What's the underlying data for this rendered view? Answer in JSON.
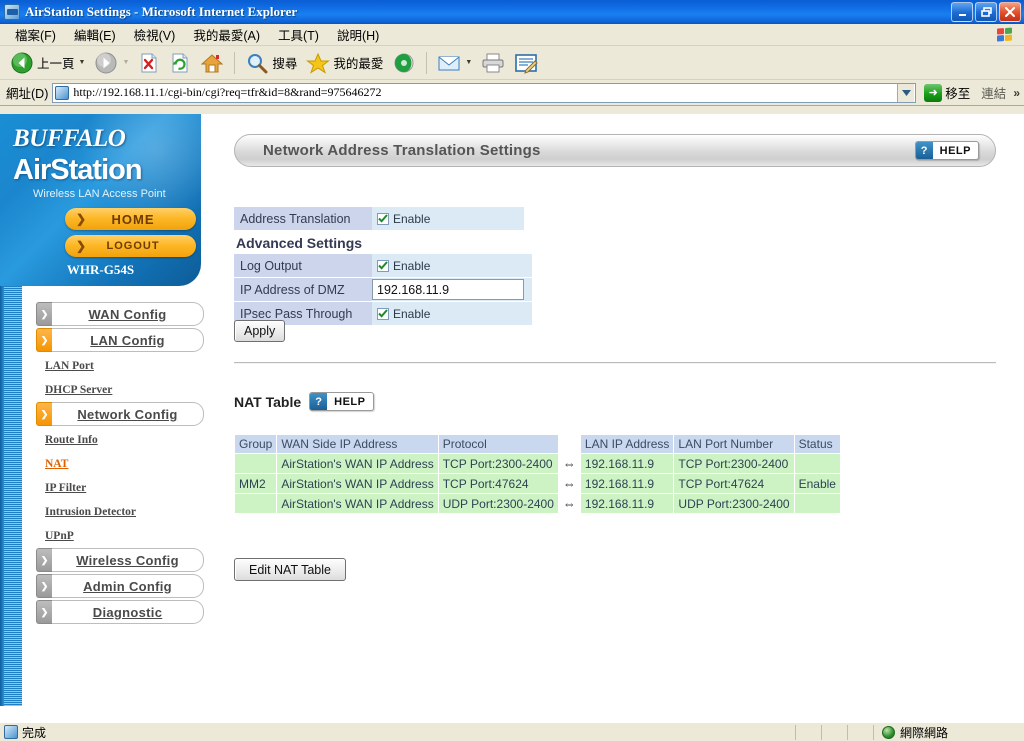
{
  "window": {
    "title": "AirStation Settings - Microsoft Internet Explorer",
    "app_icon": "ie-document-icon",
    "minimize_label": "Minimize",
    "restore_label": "Restore",
    "close_label": "Close"
  },
  "menubar": {
    "items": [
      {
        "label": "檔案(F)",
        "name": "menu-file"
      },
      {
        "label": "編輯(E)",
        "name": "menu-edit"
      },
      {
        "label": "檢視(V)",
        "name": "menu-view"
      },
      {
        "label": "我的最愛(A)",
        "name": "menu-favorites"
      },
      {
        "label": "工具(T)",
        "name": "menu-tools"
      },
      {
        "label": "說明(H)",
        "name": "menu-help"
      }
    ]
  },
  "toolbar": {
    "back_label": "上一頁",
    "forward_label": "",
    "search_label": "搜尋",
    "favorites_label": "我的最愛",
    "icons": {
      "back": "back-arrow-icon",
      "forward": "forward-arrow-icon",
      "stop": "stop-icon",
      "refresh": "refresh-icon",
      "home": "home-icon",
      "search": "magnifier-icon",
      "favorites": "star-icon",
      "media": "media-icon",
      "mail": "mail-icon",
      "print": "printer-icon",
      "edit": "edit-page-icon"
    }
  },
  "addressbar": {
    "label": "網址(D)",
    "url": "http://192.168.11.1/cgi-bin/cgi?req=tfr&id=8&rand=975646272",
    "go_label": "移至",
    "links_label": "連結",
    "overflow": "»"
  },
  "sidebar": {
    "brand": "BUFFALO",
    "product": "AirStation",
    "tagline": "Wireless LAN Access Point",
    "home_button": "HOME",
    "logout_button": "LOGOUT",
    "model": "WHR-G54S",
    "menu": [
      {
        "label": "WAN Config",
        "type": "main",
        "active": false,
        "name": "sidebar-item-wan-config"
      },
      {
        "label": "LAN Config",
        "type": "main",
        "active": true,
        "name": "sidebar-item-lan-config"
      },
      {
        "label": "LAN Port",
        "type": "sub",
        "current": false,
        "name": "sidebar-item-lan-port"
      },
      {
        "label": "DHCP Server",
        "type": "sub",
        "current": false,
        "name": "sidebar-item-dhcp-server"
      },
      {
        "label": "Network Config",
        "type": "main",
        "active": true,
        "name": "sidebar-item-network-config"
      },
      {
        "label": "Route Info",
        "type": "sub",
        "current": false,
        "name": "sidebar-item-route-info"
      },
      {
        "label": "NAT",
        "type": "sub",
        "current": true,
        "name": "sidebar-item-nat"
      },
      {
        "label": "IP Filter",
        "type": "sub",
        "current": false,
        "name": "sidebar-item-ip-filter"
      },
      {
        "label": "Intrusion Detector",
        "type": "sub",
        "current": false,
        "name": "sidebar-item-intrusion-detector"
      },
      {
        "label": "UPnP",
        "type": "sub",
        "current": false,
        "name": "sidebar-item-upnp"
      },
      {
        "label": "Wireless Config",
        "type": "main",
        "active": false,
        "name": "sidebar-item-wireless-config"
      },
      {
        "label": "Admin Config",
        "type": "main",
        "active": false,
        "name": "sidebar-item-admin-config"
      },
      {
        "label": "Diagnostic",
        "type": "main",
        "active": false,
        "name": "sidebar-item-diagnostic"
      }
    ]
  },
  "main": {
    "page_title": "Network Address Translation Settings",
    "help_label": "HELP",
    "help_mark": "?",
    "settings": {
      "address_translation_label": "Address Translation",
      "address_translation_value": "Enable",
      "address_translation_checked": true,
      "advanced_heading": "Advanced Settings",
      "log_output_label": "Log Output",
      "log_output_value": "Enable",
      "log_output_checked": true,
      "dmz_label": "IP Address of DMZ",
      "dmz_value": "192.168.11.9",
      "ipsec_label": "IPsec Pass Through",
      "ipsec_value": "Enable",
      "ipsec_checked": true,
      "apply_label": "Apply"
    },
    "nat_table": {
      "section_label": "NAT Table",
      "help_label": "HELP",
      "columns": [
        "Group",
        "WAN Side IP Address",
        "Protocol",
        "",
        "LAN IP Address",
        "LAN Port Number",
        "Status"
      ],
      "arrow_glyph": "⇔",
      "rows": [
        {
          "group": "",
          "wan_ip": "AirStation's WAN IP Address",
          "protocol": "TCP Port:2300-2400",
          "arrow": "⇔",
          "lan_ip": "192.168.11.9",
          "lan_port": "TCP Port:2300-2400",
          "status": ""
        },
        {
          "group": "MM2",
          "wan_ip": "AirStation's WAN IP Address",
          "protocol": "TCP Port:47624",
          "arrow": "⇔",
          "lan_ip": "192.168.11.9",
          "lan_port": "TCP Port:47624",
          "status": "Enable"
        },
        {
          "group": "",
          "wan_ip": "AirStation's WAN IP Address",
          "protocol": "UDP Port:2300-2400",
          "arrow": "⇔",
          "lan_ip": "192.168.11.9",
          "lan_port": "UDP Port:2300-2400",
          "status": ""
        }
      ],
      "edit_button_label": "Edit NAT Table"
    }
  },
  "statusbar": {
    "status_text": "完成",
    "zone_text": "網際網路",
    "status_icon": "page-icon",
    "zone_icon": "globe-icon"
  }
}
